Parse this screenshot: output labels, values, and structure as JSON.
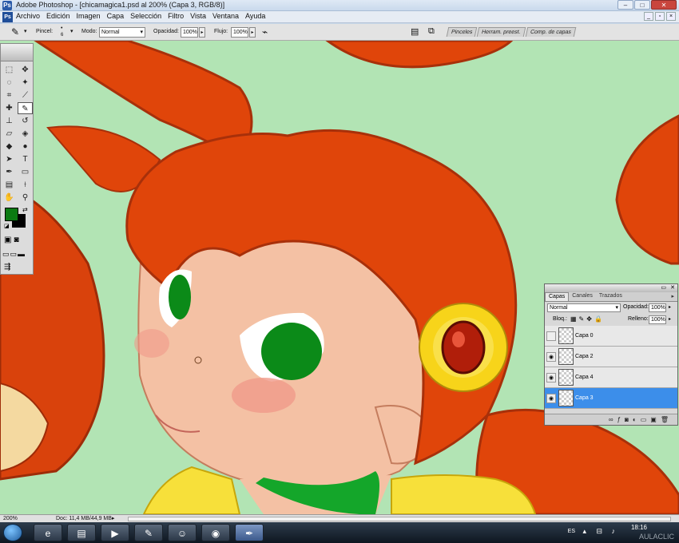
{
  "window": {
    "title": "Adobe Photoshop - [chicamagica1.psd al 200% (Capa 3, RGB/8)]",
    "app_icon": "Ps"
  },
  "menu": [
    "Archivo",
    "Edición",
    "Imagen",
    "Capa",
    "Selección",
    "Filtro",
    "Vista",
    "Ventana",
    "Ayuda"
  ],
  "options": {
    "brush_label": "Pincel:",
    "brush_size": "6",
    "mode_label": "Modo:",
    "mode_value": "Normal",
    "opacity_label": "Opacidad:",
    "opacity_value": "100%",
    "flow_label": "Flujo:",
    "flow_value": "100%"
  },
  "wells": [
    "Pinceles",
    "Herram. preest.",
    "Comp. de capas"
  ],
  "colors": {
    "foreground": "#0b7a12",
    "background": "#000000",
    "canvas_bg": "#b2e4b4",
    "hair": "#e0450a",
    "selected_layer": "#3c8eea"
  },
  "layers_panel": {
    "tabs": [
      "Capas",
      "Canales",
      "Trazados"
    ],
    "blend_mode": "Normal",
    "opacity_label": "Opacidad:",
    "opacity_value": "100%",
    "lock_label": "Bloq.:",
    "fill_label": "Relleno:",
    "fill_value": "100%",
    "layers": [
      {
        "name": "Capa 0",
        "visible": false,
        "selected": false
      },
      {
        "name": "Capa 2",
        "visible": true,
        "selected": false
      },
      {
        "name": "Capa 4",
        "visible": true,
        "selected": false
      },
      {
        "name": "Capa 3",
        "visible": true,
        "selected": true
      }
    ]
  },
  "status": {
    "zoom": "200%",
    "doc": "Doc: 11,4 MB/44,9 MB"
  },
  "taskbar": {
    "lang": "ES",
    "time": "18:16",
    "watermark": "AULACLIC"
  }
}
